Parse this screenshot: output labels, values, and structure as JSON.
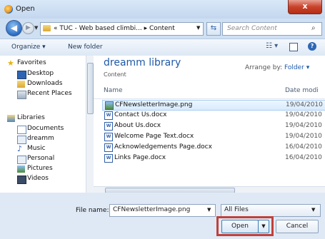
{
  "window": {
    "title": "Open",
    "close_label": "x"
  },
  "nav": {
    "back_glyph": "◀",
    "forward_glyph": "▶",
    "history_glyph": "▼",
    "address": "« TUC - Web based climbi... ▸ Content",
    "address_drop": "▼",
    "refresh_glyph": "⇆",
    "search_placeholder": "Search Content",
    "search_glyph": "⌕"
  },
  "toolbar": {
    "organize_label": "Organize ▾",
    "new_folder_label": "New folder",
    "views_glyph": "☷ ▾",
    "help_glyph": "?"
  },
  "sidebar": {
    "items": [
      {
        "label": "Favorites",
        "icon": "star-icon"
      },
      {
        "label": "Desktop",
        "icon": "desktop-icon"
      },
      {
        "label": "Downloads",
        "icon": "downloads-icon"
      },
      {
        "label": "Recent Places",
        "icon": "recent-places-icon"
      },
      {
        "label": "Libraries",
        "icon": "libraries-icon"
      },
      {
        "label": "Documents",
        "icon": "documents-icon"
      },
      {
        "label": "dreamm",
        "icon": "library-icon"
      },
      {
        "label": "Music",
        "icon": "music-icon"
      },
      {
        "label": "Personal",
        "icon": "library-icon"
      },
      {
        "label": "Pictures",
        "icon": "pictures-icon"
      },
      {
        "label": "Videos",
        "icon": "videos-icon"
      }
    ]
  },
  "content": {
    "library_title": "dreamm library",
    "library_subtitle": "Content",
    "arrange_label": "Arrange by:",
    "arrange_value": "Folder ▾",
    "columns": {
      "name": "Name",
      "date": "Date modi"
    },
    "files": [
      {
        "name": "CFNewsletterImage.png",
        "date": "19/04/2010",
        "icon": "image-file-icon",
        "selected": true
      },
      {
        "name": "Contact Us.docx",
        "date": "19/04/2010",
        "icon": "word-doc-icon",
        "selected": false
      },
      {
        "name": "About Us.docx",
        "date": "19/04/2010",
        "icon": "word-doc-icon",
        "selected": false
      },
      {
        "name": "Welcome Page Text.docx",
        "date": "19/04/2010",
        "icon": "word-doc-icon",
        "selected": false
      },
      {
        "name": "Acknowledgements Page.docx",
        "date": "16/04/2010",
        "icon": "word-doc-icon",
        "selected": false
      },
      {
        "name": "Links Page.docx",
        "date": "16/04/2010",
        "icon": "word-doc-icon",
        "selected": false
      }
    ]
  },
  "footer": {
    "file_name_label": "File name:",
    "file_name_value": "CFNewsletterImage.png",
    "file_type_value": "All Files",
    "dropdown_glyph": "▼",
    "open_label": "Open",
    "open_split_glyph": "▼",
    "cancel_label": "Cancel"
  },
  "colors": {
    "accent": "#1e5aa8",
    "highlight_box": "#c0413c",
    "close_button": "#c9432b"
  }
}
